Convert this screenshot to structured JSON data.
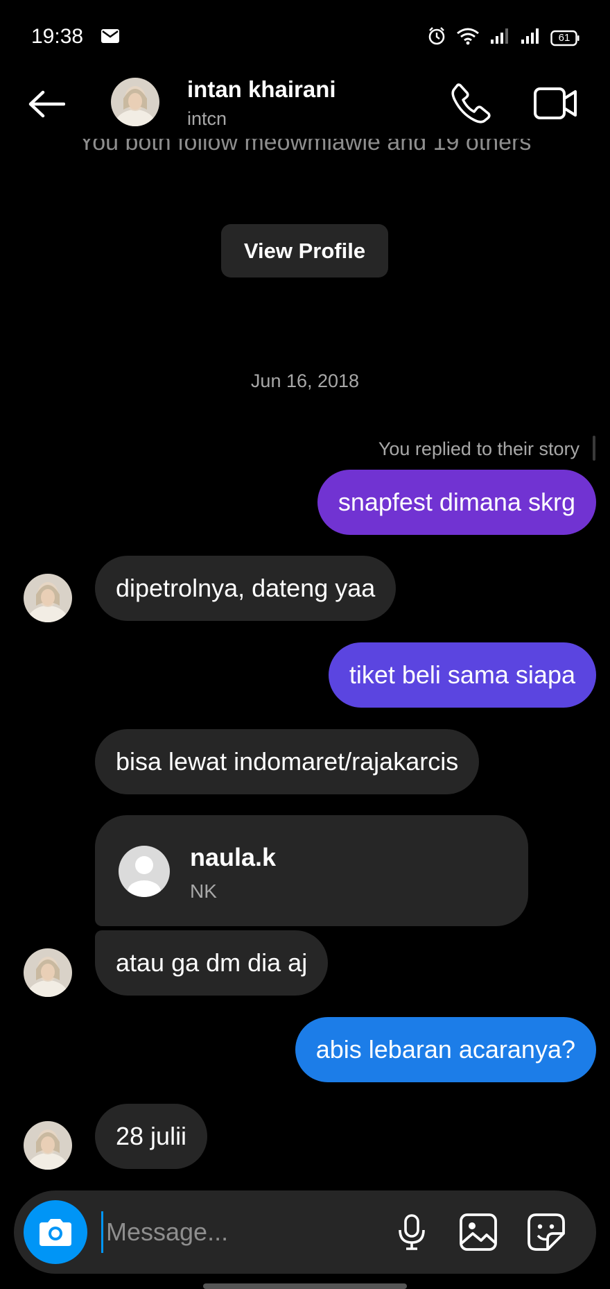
{
  "status_bar": {
    "time": "19:38",
    "battery": "61",
    "icons": [
      "mail-icon",
      "alarm-icon",
      "wifi-icon",
      "signal-icon",
      "signal-icon",
      "battery-icon"
    ]
  },
  "header": {
    "name": "intan khairani",
    "username": "intcn",
    "icons": [
      "back-arrow-icon",
      "phone-icon",
      "video-camera-icon"
    ]
  },
  "profile_section": {
    "followers_text": "You both follow meowmiawie and 19 others",
    "view_profile_label": "View Profile"
  },
  "conversation": {
    "date_separator": "Jun 16, 2018",
    "story_reply_note": "You replied to their story",
    "messages": [
      {
        "direction": "out",
        "text": "snapfest dimana skrg",
        "color": "#7133d2"
      },
      {
        "direction": "in",
        "text": "dipetrolnya, dateng yaa"
      },
      {
        "direction": "out",
        "text": "tiket beli sama siapa",
        "color": "#5b45e0"
      },
      {
        "direction": "in",
        "text": "bisa lewat indomaret/rajakarcis"
      },
      {
        "direction": "in",
        "type": "profile_share",
        "name": "naula.k",
        "subtitle": "NK"
      },
      {
        "direction": "in",
        "text": "atau ga dm dia aj"
      },
      {
        "direction": "out",
        "text": "abis lebaran acaranya?",
        "color": "#1c7de8"
      },
      {
        "direction": "in",
        "text": "28 julii"
      }
    ]
  },
  "composer": {
    "placeholder": "Message...",
    "icons": [
      "camera-icon",
      "microphone-icon",
      "gallery-icon",
      "sticker-icon"
    ]
  },
  "colors": {
    "background": "#000000",
    "incoming_bubble": "#262626",
    "accent_blue": "#0095f6",
    "secondary_text": "#a8a8a8"
  }
}
